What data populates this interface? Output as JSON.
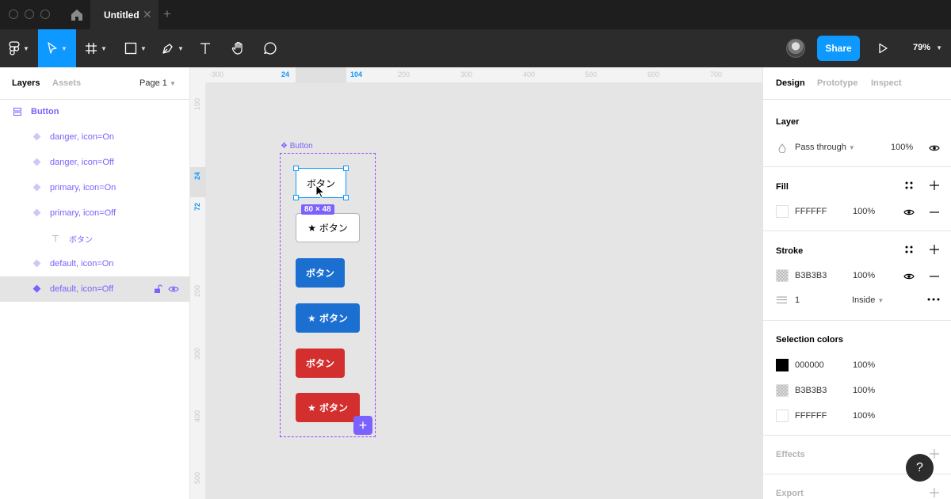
{
  "titlebar": {
    "tab_title": "Untitled",
    "tab_close": "✕",
    "tab_add": "+"
  },
  "toolbar": {
    "share_label": "Share",
    "zoom": "79%"
  },
  "left_panel": {
    "tabs": [
      "Layers",
      "Assets"
    ],
    "page": "Page 1",
    "layers": [
      {
        "label": "Button",
        "type": "component-set"
      },
      {
        "label": "danger, icon=On",
        "type": "variant"
      },
      {
        "label": "danger, icon=Off",
        "type": "variant"
      },
      {
        "label": "primary, icon=On",
        "type": "variant"
      },
      {
        "label": "primary, icon=Off",
        "type": "variant"
      },
      {
        "label": "ボタン",
        "type": "text"
      },
      {
        "label": "default, icon=On",
        "type": "variant"
      },
      {
        "label": "default, icon=Off",
        "type": "variant",
        "selected": true
      }
    ]
  },
  "canvas": {
    "ruler_top": [
      "-300",
      "24",
      "104",
      "200",
      "300",
      "400",
      "500",
      "600",
      "700"
    ],
    "ruler_left": [
      "100",
      "24",
      "72",
      "200",
      "300",
      "400",
      "500"
    ],
    "frame_label": "Button",
    "selection_size": "80 × 48",
    "buttons": [
      {
        "variant": "default",
        "icon": false,
        "label": "ボタン"
      },
      {
        "variant": "default",
        "icon": true,
        "label": "★  ボタン"
      },
      {
        "variant": "primary",
        "icon": false,
        "label": "ボタン"
      },
      {
        "variant": "primary",
        "icon": true,
        "label": "★  ボタン"
      },
      {
        "variant": "danger",
        "icon": false,
        "label": "ボタン"
      },
      {
        "variant": "danger",
        "icon": true,
        "label": "★  ボタン"
      }
    ],
    "add_variant": "+"
  },
  "right_panel": {
    "tabs": [
      "Design",
      "Prototype",
      "Inspect"
    ],
    "layer": {
      "title": "Layer",
      "blend": "Pass through",
      "opacity": "100%"
    },
    "fill": {
      "title": "Fill",
      "color": "FFFFFF",
      "opacity": "100%"
    },
    "stroke": {
      "title": "Stroke",
      "color": "B3B3B3",
      "opacity": "100%",
      "weight": "1",
      "position": "Inside"
    },
    "selection_colors": {
      "title": "Selection colors",
      "items": [
        {
          "hex": "000000",
          "opacity": "100%",
          "swatch": "#000000"
        },
        {
          "hex": "B3B3B3",
          "opacity": "100%",
          "swatch": "checker"
        },
        {
          "hex": "FFFFFF",
          "opacity": "100%",
          "swatch": "#ffffff"
        }
      ]
    },
    "effects": {
      "title": "Effects"
    },
    "export": {
      "title": "Export"
    }
  },
  "help_label": "?"
}
